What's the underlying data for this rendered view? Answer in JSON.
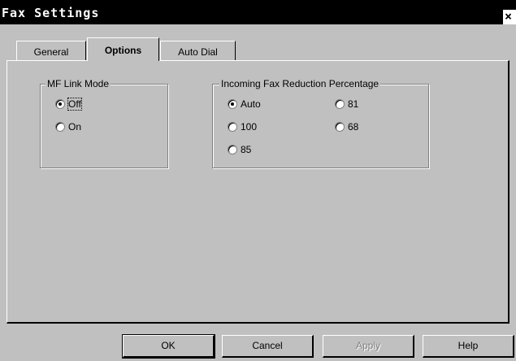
{
  "window": {
    "title": "Fax Settings",
    "close_label": "×"
  },
  "tabs": [
    {
      "label": "General",
      "active": false
    },
    {
      "label": "Options",
      "active": true
    },
    {
      "label": "Auto Dial",
      "active": false
    }
  ],
  "mf_link_mode": {
    "title": "MF Link Mode",
    "options": [
      {
        "label": "Off",
        "selected": true
      },
      {
        "label": "On",
        "selected": false
      }
    ]
  },
  "reduction": {
    "title": "Incoming Fax Reduction Percentage",
    "options": [
      {
        "label": "Auto",
        "selected": true
      },
      {
        "label": "100",
        "selected": false
      },
      {
        "label": "85",
        "selected": false
      },
      {
        "label": "81",
        "selected": false
      },
      {
        "label": "68",
        "selected": false
      }
    ]
  },
  "buttons": {
    "ok": "OK",
    "cancel": "Cancel",
    "apply": "Apply",
    "help": "Help"
  },
  "colors": {
    "dialog_face": "#c0c0c0",
    "titlebar": "#000000",
    "disabled_text": "#808080"
  }
}
